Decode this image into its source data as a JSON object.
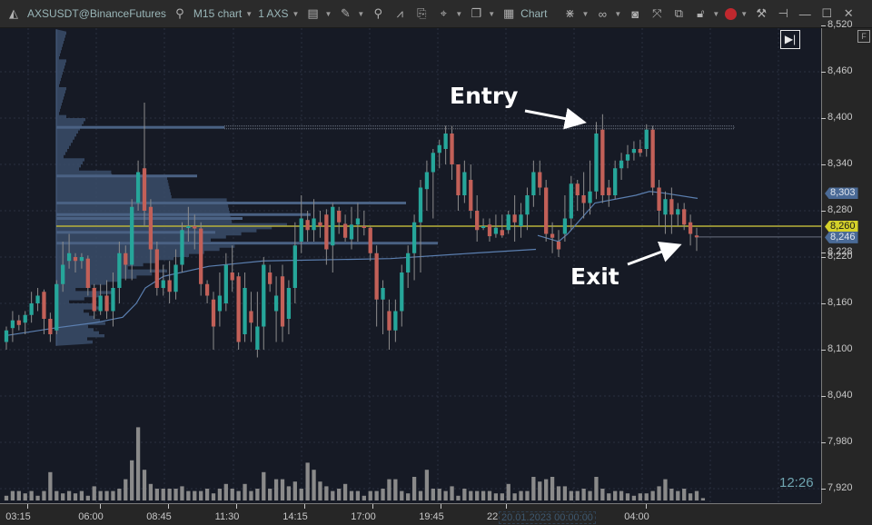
{
  "toolbar": {
    "symbol": "AXSUSDT@BinanceFutures",
    "timeframe": "M15 chart",
    "quantity": "1 AXS",
    "chart_label": "Chart",
    "record_color": "#c0282e"
  },
  "chart": {
    "annotations": {
      "entry": "Entry",
      "exit": "Exit"
    },
    "clock": "12:26",
    "date_label": "20.01.2023 00:00:00",
    "date_prefix": "22",
    "f_button": "F",
    "goto_end_icon": "▶|"
  },
  "colors": {
    "bull": "#26a69a",
    "bear": "#c26058",
    "vwap": "#5b7fb0",
    "level": "#b8b23a",
    "profile": "#3a4d6a",
    "volume": "#8a8a8a"
  },
  "chart_data": {
    "type": "candlestick",
    "ylim": [
      7900,
      8525
    ],
    "price_ticks": [
      "8,520",
      "8,460",
      "8,400",
      "8,340",
      "8,280",
      "8,220",
      "8,160",
      "8,100",
      "8,040",
      "7,980",
      "7,920"
    ],
    "price_tags": [
      {
        "label": "8,303",
        "value": 8303,
        "color": "#4a6a96"
      },
      {
        "label": "8,260",
        "value": 8260,
        "color": "#d4d02a",
        "text_color": "#1a1a1a"
      },
      {
        "label": "8,246",
        "value": 8246,
        "color": "#4a6a96"
      }
    ],
    "extra_tick": "8,228",
    "time_ticks": [
      "03:15",
      "06:00",
      "08:45",
      "11:30",
      "14:15",
      "17:00",
      "19:45",
      "22",
      "04:00"
    ],
    "level_line": 8260,
    "resistance_line": 8388,
    "candles": [
      [
        8110,
        8125,
        8100,
        8130
      ],
      [
        8128,
        8138,
        8110,
        8150
      ],
      [
        8138,
        8132,
        8125,
        8145
      ],
      [
        8135,
        8145,
        8120,
        8150
      ],
      [
        8145,
        8160,
        8135,
        8175
      ],
      [
        8160,
        8170,
        8150,
        8180
      ],
      [
        8175,
        8140,
        8120,
        8178
      ],
      [
        8140,
        8120,
        8110,
        8148
      ],
      [
        8125,
        8185,
        8120,
        8190
      ],
      [
        8185,
        8210,
        8175,
        8240
      ],
      [
        8215,
        8225,
        8205,
        8250
      ],
      [
        8220,
        8215,
        8200,
        8225
      ],
      [
        8215,
        8220,
        8205,
        8225
      ],
      [
        8218,
        8180,
        8170,
        8222
      ],
      [
        8180,
        8150,
        8140,
        8185
      ],
      [
        8150,
        8170,
        8145,
        8185
      ],
      [
        8170,
        8150,
        8140,
        8190
      ],
      [
        8150,
        8180,
        8130,
        8200
      ],
      [
        8180,
        8225,
        8160,
        8240
      ],
      [
        8225,
        8210,
        8190,
        8235
      ],
      [
        8210,
        8285,
        8190,
        8295
      ],
      [
        8290,
        8330,
        8280,
        8345
      ],
      [
        8335,
        8280,
        8260,
        8420
      ],
      [
        8285,
        8230,
        8200,
        8295
      ],
      [
        8230,
        8180,
        8170,
        8240
      ],
      [
        8180,
        8190,
        8170,
        8210
      ],
      [
        8190,
        8175,
        8160,
        8215
      ],
      [
        8175,
        8210,
        8165,
        8230
      ],
      [
        8210,
        8255,
        8200,
        8265
      ],
      [
        8258,
        8260,
        8240,
        8285
      ],
      [
        8260,
        8257,
        8230,
        8275
      ],
      [
        8257,
        8185,
        8170,
        8265
      ],
      [
        8185,
        8170,
        8160,
        8190
      ],
      [
        8165,
        8130,
        8100,
        8175
      ],
      [
        8150,
        8170,
        8130,
        8200
      ],
      [
        8160,
        8210,
        8150,
        8225
      ],
      [
        8200,
        8190,
        8175,
        8235
      ],
      [
        8195,
        8110,
        8100,
        8200
      ],
      [
        8120,
        8180,
        8110,
        8200
      ],
      [
        8150,
        8135,
        8110,
        8175
      ],
      [
        8100,
        8130,
        8090,
        8175
      ],
      [
        8130,
        8210,
        8100,
        8220
      ],
      [
        8200,
        8185,
        8175,
        8210
      ],
      [
        8150,
        8170,
        8110,
        8195
      ],
      [
        8195,
        8130,
        8110,
        8210
      ],
      [
        8140,
        8180,
        8120,
        8190
      ],
      [
        8180,
        8235,
        8160,
        8265
      ],
      [
        8240,
        8270,
        8225,
        8300
      ],
      [
        8268,
        8255,
        8240,
        8280
      ],
      [
        8255,
        8270,
        8240,
        8295
      ],
      [
        8265,
        8260,
        8245,
        8280
      ],
      [
        8275,
        8230,
        8210,
        8282
      ],
      [
        8235,
        8285,
        8200,
        8290
      ],
      [
        8280,
        8265,
        8250,
        8285
      ],
      [
        8263,
        8245,
        8240,
        8275
      ],
      [
        8243,
        8262,
        8230,
        8285
      ],
      [
        8262,
        8270,
        8240,
        8290
      ],
      [
        8260,
        8258,
        8248,
        8280
      ],
      [
        8258,
        8225,
        8215,
        8260
      ],
      [
        8225,
        8165,
        8130,
        8235
      ],
      [
        8165,
        8180,
        8120,
        8190
      ],
      [
        8150,
        8125,
        8100,
        8165
      ],
      [
        8125,
        8150,
        8110,
        8165
      ],
      [
        8150,
        8200,
        8130,
        8210
      ],
      [
        8200,
        8225,
        8180,
        8235
      ],
      [
        8225,
        8265,
        8190,
        8275
      ],
      [
        8265,
        8310,
        8200,
        8320
      ],
      [
        8308,
        8330,
        8280,
        8345
      ],
      [
        8330,
        8355,
        8270,
        8360
      ],
      [
        8355,
        8365,
        8335,
        8372
      ],
      [
        8360,
        8380,
        8340,
        8390
      ],
      [
        8380,
        8340,
        8320,
        8390
      ],
      [
        8340,
        8300,
        8280,
        8340
      ],
      [
        8300,
        8330,
        8290,
        8345
      ],
      [
        8320,
        8280,
        8270,
        8340
      ],
      [
        8280,
        8255,
        8240,
        8300
      ],
      [
        8260,
        8260,
        8255,
        8270
      ],
      [
        8262,
        8247,
        8240,
        8270
      ],
      [
        8250,
        8258,
        8245,
        8275
      ],
      [
        8255,
        8248,
        8245,
        8275
      ],
      [
        8255,
        8275,
        8250,
        8280
      ],
      [
        8275,
        8265,
        8240,
        8300
      ],
      [
        8260,
        8275,
        8245,
        8290
      ],
      [
        8275,
        8300,
        8255,
        8310
      ],
      [
        8300,
        8330,
        8285,
        8345
      ],
      [
        8330,
        8310,
        8300,
        8345
      ],
      [
        8310,
        8250,
        8240,
        8320
      ],
      [
        8250,
        8245,
        8225,
        8265
      ],
      [
        8240,
        8230,
        8220,
        8255
      ],
      [
        8250,
        8270,
        8240,
        8300
      ],
      [
        8270,
        8315,
        8255,
        8325
      ],
      [
        8315,
        8300,
        8280,
        8320
      ],
      [
        8300,
        8290,
        8270,
        8330
      ],
      [
        8290,
        8305,
        8275,
        8345
      ],
      [
        8305,
        8380,
        8295,
        8395
      ],
      [
        8385,
        8300,
        8290,
        8405
      ],
      [
        8310,
        8300,
        8285,
        8320
      ],
      [
        8300,
        8335,
        8295,
        8345
      ],
      [
        8335,
        8345,
        8320,
        8355
      ],
      [
        8345,
        8353,
        8335,
        8365
      ],
      [
        8355,
        8360,
        8345,
        8370
      ],
      [
        8360,
        8355,
        8350,
        8372
      ],
      [
        8360,
        8385,
        8350,
        8392
      ],
      [
        8385,
        8310,
        8300,
        8390
      ],
      [
        8310,
        8280,
        8260,
        8320
      ],
      [
        8275,
        8295,
        8250,
        8305
      ],
      [
        8295,
        8275,
        8250,
        8310
      ],
      [
        8275,
        8282,
        8260,
        8290
      ],
      [
        8282,
        8262,
        8255,
        8290
      ],
      [
        8265,
        8250,
        8235,
        8275
      ],
      [
        8248,
        8246,
        8228,
        8258
      ]
    ],
    "volumes": [
      2,
      4,
      4,
      3,
      4,
      2,
      4,
      12,
      4,
      3,
      4,
      3,
      4,
      2,
      6,
      4,
      4,
      4,
      5,
      9,
      17,
      31,
      13,
      7,
      5,
      5,
      5,
      5,
      6,
      4,
      4,
      4,
      5,
      3,
      5,
      7,
      5,
      4,
      7,
      4,
      5,
      12,
      5,
      9,
      9,
      6,
      8,
      5,
      16,
      13,
      8,
      6,
      4,
      5,
      7,
      4,
      4,
      2,
      4,
      4,
      5,
      9,
      9,
      4,
      3,
      10,
      4,
      13,
      5,
      5,
      4,
      6,
      2,
      5,
      4,
      4,
      4,
      4,
      3,
      3,
      7,
      3,
      4,
      4,
      10,
      8,
      9,
      10,
      6,
      6,
      4,
      4,
      5,
      4,
      10,
      5,
      3,
      4,
      4,
      3,
      2,
      3,
      3,
      4,
      6,
      9,
      5,
      4,
      5,
      3,
      4,
      1
    ]
  }
}
